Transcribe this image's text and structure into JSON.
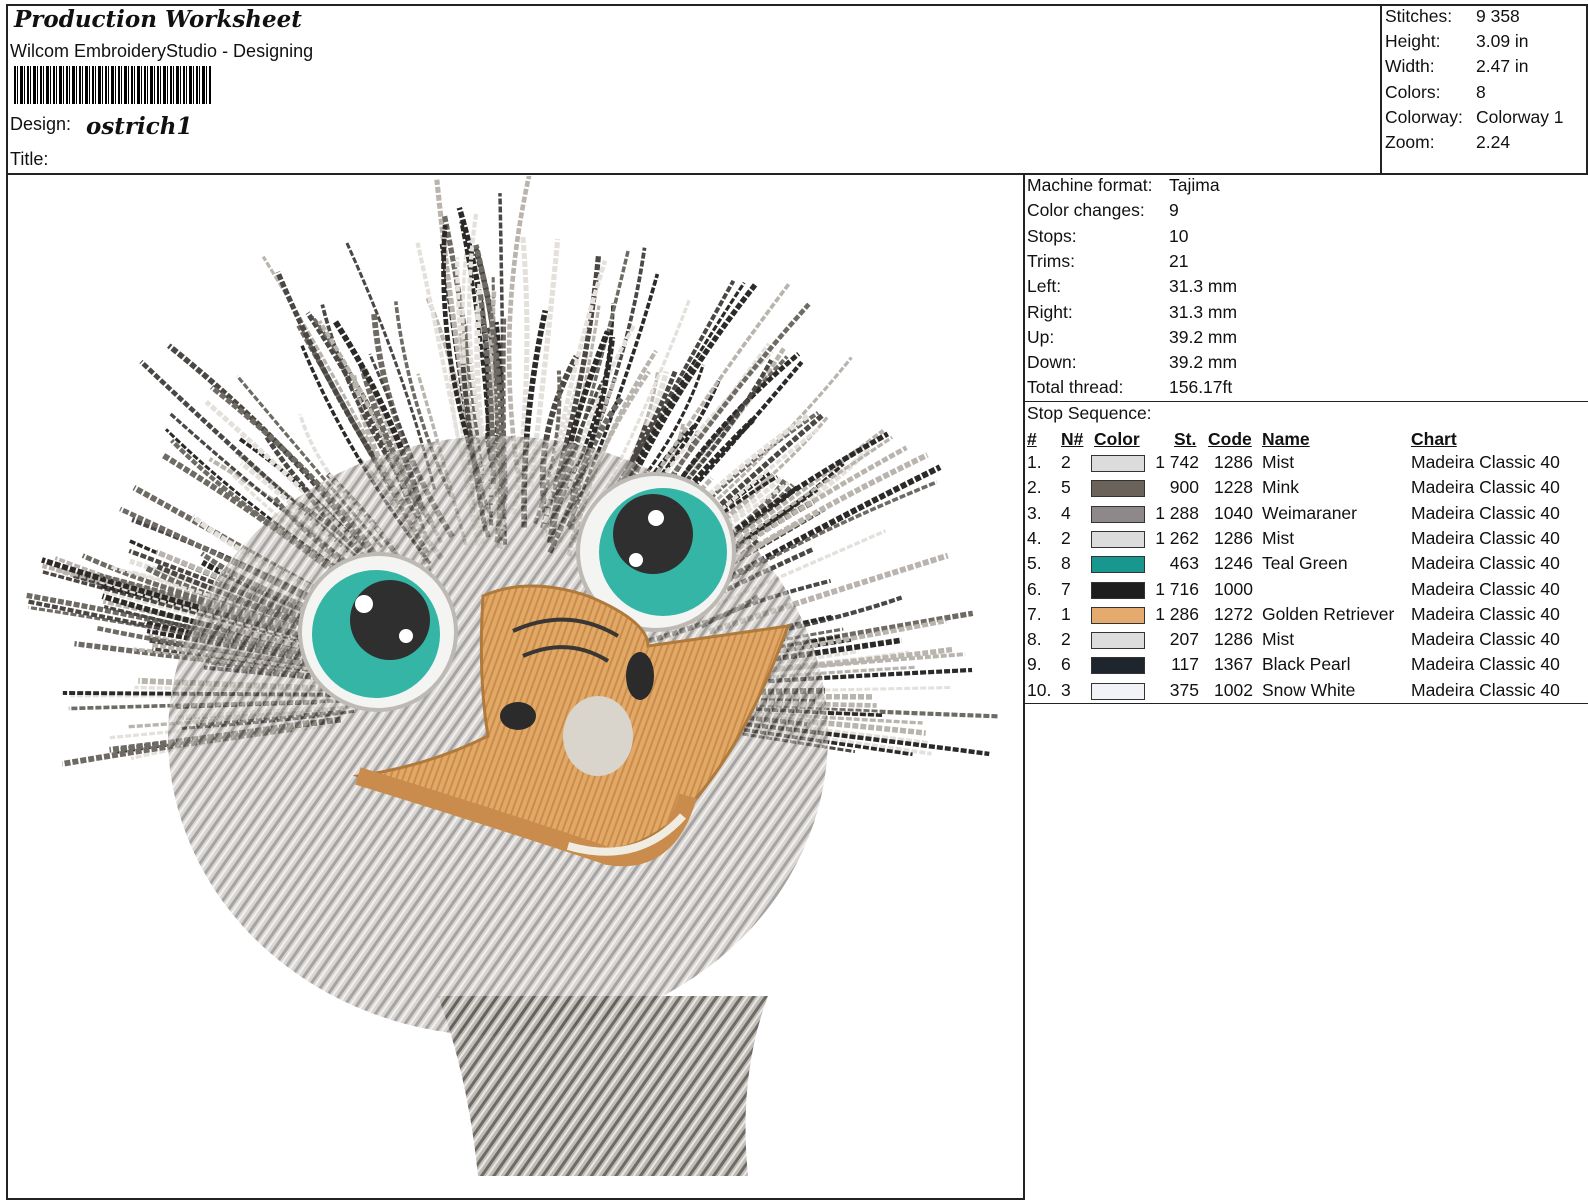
{
  "header": {
    "title": "Production Worksheet",
    "app": "Wilcom EmbroideryStudio - Designing",
    "design_label": "Design:",
    "design_value": "ostrich1",
    "title_label": "Title:"
  },
  "stats": [
    {
      "k": "Stitches:",
      "v": "9 358"
    },
    {
      "k": "Height:",
      "v": "3.09 in"
    },
    {
      "k": "Width:",
      "v": "2.47 in"
    },
    {
      "k": "Colors:",
      "v": "8"
    },
    {
      "k": "Colorway:",
      "v": "Colorway 1"
    },
    {
      "k": "Zoom:",
      "v": "2.24"
    }
  ],
  "machine": [
    {
      "k": "Machine format:",
      "v": "Tajima"
    },
    {
      "k": "Color changes:",
      "v": "9"
    },
    {
      "k": "Stops:",
      "v": "10"
    },
    {
      "k": "Trims:",
      "v": "21"
    },
    {
      "k": "Left:",
      "v": "31.3 mm"
    },
    {
      "k": "Right:",
      "v": "31.3 mm"
    },
    {
      "k": "Up:",
      "v": "39.2 mm"
    },
    {
      "k": "Down:",
      "v": "39.2 mm"
    },
    {
      "k": "Total thread:",
      "v": "156.17ft"
    }
  ],
  "stop_sequence": {
    "label": "Stop Sequence:",
    "headers": {
      "num": "#",
      "n": "N#",
      "color": "Color",
      "st": "St.",
      "code": "Code",
      "name": "Name",
      "chart": "Chart"
    },
    "rows": [
      {
        "num": "1.",
        "n": "2",
        "hex": "#dcdcdc",
        "st": "1 742",
        "code": "1286",
        "name": "Mist",
        "chart": "Madeira Classic 40"
      },
      {
        "num": "2.",
        "n": "5",
        "hex": "#6b6359",
        "st": "900",
        "code": "1228",
        "name": "Mink",
        "chart": "Madeira Classic 40"
      },
      {
        "num": "3.",
        "n": "4",
        "hex": "#8e888a",
        "st": "1 288",
        "code": "1040",
        "name": "Weimaraner",
        "chart": "Madeira Classic 40"
      },
      {
        "num": "4.",
        "n": "2",
        "hex": "#dcdcdc",
        "st": "1 262",
        "code": "1286",
        "name": "Mist",
        "chart": "Madeira Classic 40"
      },
      {
        "num": "5.",
        "n": "8",
        "hex": "#18978e",
        "st": "463",
        "code": "1246",
        "name": "Teal Green",
        "chart": "Madeira Classic 40"
      },
      {
        "num": "6.",
        "n": "7",
        "hex": "#1e1e1e",
        "st": "1 716",
        "code": "1000",
        "name": "",
        "chart": "Madeira Classic 40"
      },
      {
        "num": "7.",
        "n": "1",
        "hex": "#e5ab6e",
        "st": "1 286",
        "code": "1272",
        "name": "Golden Retriever",
        "chart": "Madeira Classic 40"
      },
      {
        "num": "8.",
        "n": "2",
        "hex": "#dcdcdc",
        "st": "207",
        "code": "1286",
        "name": "Mist",
        "chart": "Madeira Classic 40"
      },
      {
        "num": "9.",
        "n": "6",
        "hex": "#1f252c",
        "st": "117",
        "code": "1367",
        "name": "Black Pearl",
        "chart": "Madeira Classic 40"
      },
      {
        "num": "10.",
        "n": "3",
        "hex": "#f1f3f7",
        "st": "375",
        "code": "1002",
        "name": "Snow White",
        "chart": "Madeira Classic 40"
      }
    ]
  }
}
